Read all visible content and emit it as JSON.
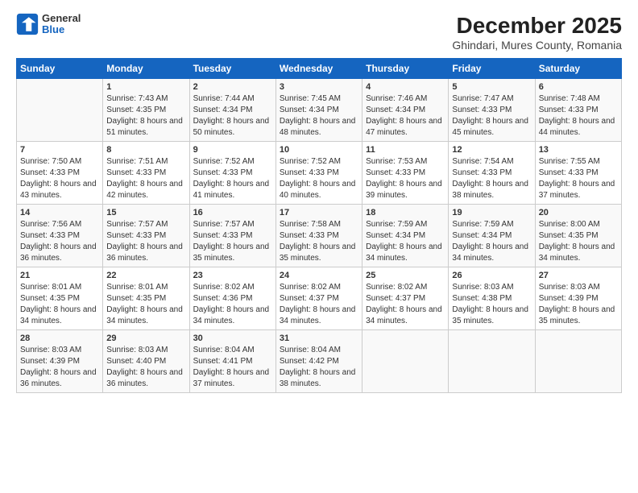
{
  "logo": {
    "general": "General",
    "blue": "Blue"
  },
  "title": "December 2025",
  "subtitle": "Ghindari, Mures County, Romania",
  "days_header": [
    "Sunday",
    "Monday",
    "Tuesday",
    "Wednesday",
    "Thursday",
    "Friday",
    "Saturday"
  ],
  "weeks": [
    [
      {
        "num": "",
        "detail": ""
      },
      {
        "num": "1",
        "detail": "Sunrise: 7:43 AM\nSunset: 4:35 PM\nDaylight: 8 hours\nand 51 minutes."
      },
      {
        "num": "2",
        "detail": "Sunrise: 7:44 AM\nSunset: 4:34 PM\nDaylight: 8 hours\nand 50 minutes."
      },
      {
        "num": "3",
        "detail": "Sunrise: 7:45 AM\nSunset: 4:34 PM\nDaylight: 8 hours\nand 48 minutes."
      },
      {
        "num": "4",
        "detail": "Sunrise: 7:46 AM\nSunset: 4:34 PM\nDaylight: 8 hours\nand 47 minutes."
      },
      {
        "num": "5",
        "detail": "Sunrise: 7:47 AM\nSunset: 4:33 PM\nDaylight: 8 hours\nand 45 minutes."
      },
      {
        "num": "6",
        "detail": "Sunrise: 7:48 AM\nSunset: 4:33 PM\nDaylight: 8 hours\nand 44 minutes."
      }
    ],
    [
      {
        "num": "7",
        "detail": "Sunrise: 7:50 AM\nSunset: 4:33 PM\nDaylight: 8 hours\nand 43 minutes."
      },
      {
        "num": "8",
        "detail": "Sunrise: 7:51 AM\nSunset: 4:33 PM\nDaylight: 8 hours\nand 42 minutes."
      },
      {
        "num": "9",
        "detail": "Sunrise: 7:52 AM\nSunset: 4:33 PM\nDaylight: 8 hours\nand 41 minutes."
      },
      {
        "num": "10",
        "detail": "Sunrise: 7:52 AM\nSunset: 4:33 PM\nDaylight: 8 hours\nand 40 minutes."
      },
      {
        "num": "11",
        "detail": "Sunrise: 7:53 AM\nSunset: 4:33 PM\nDaylight: 8 hours\nand 39 minutes."
      },
      {
        "num": "12",
        "detail": "Sunrise: 7:54 AM\nSunset: 4:33 PM\nDaylight: 8 hours\nand 38 minutes."
      },
      {
        "num": "13",
        "detail": "Sunrise: 7:55 AM\nSunset: 4:33 PM\nDaylight: 8 hours\nand 37 minutes."
      }
    ],
    [
      {
        "num": "14",
        "detail": "Sunrise: 7:56 AM\nSunset: 4:33 PM\nDaylight: 8 hours\nand 36 minutes."
      },
      {
        "num": "15",
        "detail": "Sunrise: 7:57 AM\nSunset: 4:33 PM\nDaylight: 8 hours\nand 36 minutes."
      },
      {
        "num": "16",
        "detail": "Sunrise: 7:57 AM\nSunset: 4:33 PM\nDaylight: 8 hours\nand 35 minutes."
      },
      {
        "num": "17",
        "detail": "Sunrise: 7:58 AM\nSunset: 4:33 PM\nDaylight: 8 hours\nand 35 minutes."
      },
      {
        "num": "18",
        "detail": "Sunrise: 7:59 AM\nSunset: 4:34 PM\nDaylight: 8 hours\nand 34 minutes."
      },
      {
        "num": "19",
        "detail": "Sunrise: 7:59 AM\nSunset: 4:34 PM\nDaylight: 8 hours\nand 34 minutes."
      },
      {
        "num": "20",
        "detail": "Sunrise: 8:00 AM\nSunset: 4:35 PM\nDaylight: 8 hours\nand 34 minutes."
      }
    ],
    [
      {
        "num": "21",
        "detail": "Sunrise: 8:01 AM\nSunset: 4:35 PM\nDaylight: 8 hours\nand 34 minutes."
      },
      {
        "num": "22",
        "detail": "Sunrise: 8:01 AM\nSunset: 4:35 PM\nDaylight: 8 hours\nand 34 minutes."
      },
      {
        "num": "23",
        "detail": "Sunrise: 8:02 AM\nSunset: 4:36 PM\nDaylight: 8 hours\nand 34 minutes."
      },
      {
        "num": "24",
        "detail": "Sunrise: 8:02 AM\nSunset: 4:37 PM\nDaylight: 8 hours\nand 34 minutes."
      },
      {
        "num": "25",
        "detail": "Sunrise: 8:02 AM\nSunset: 4:37 PM\nDaylight: 8 hours\nand 34 minutes."
      },
      {
        "num": "26",
        "detail": "Sunrise: 8:03 AM\nSunset: 4:38 PM\nDaylight: 8 hours\nand 35 minutes."
      },
      {
        "num": "27",
        "detail": "Sunrise: 8:03 AM\nSunset: 4:39 PM\nDaylight: 8 hours\nand 35 minutes."
      }
    ],
    [
      {
        "num": "28",
        "detail": "Sunrise: 8:03 AM\nSunset: 4:39 PM\nDaylight: 8 hours\nand 36 minutes."
      },
      {
        "num": "29",
        "detail": "Sunrise: 8:03 AM\nSunset: 4:40 PM\nDaylight: 8 hours\nand 36 minutes."
      },
      {
        "num": "30",
        "detail": "Sunrise: 8:04 AM\nSunset: 4:41 PM\nDaylight: 8 hours\nand 37 minutes."
      },
      {
        "num": "31",
        "detail": "Sunrise: 8:04 AM\nSunset: 4:42 PM\nDaylight: 8 hours\nand 38 minutes."
      },
      {
        "num": "",
        "detail": ""
      },
      {
        "num": "",
        "detail": ""
      },
      {
        "num": "",
        "detail": ""
      }
    ]
  ]
}
